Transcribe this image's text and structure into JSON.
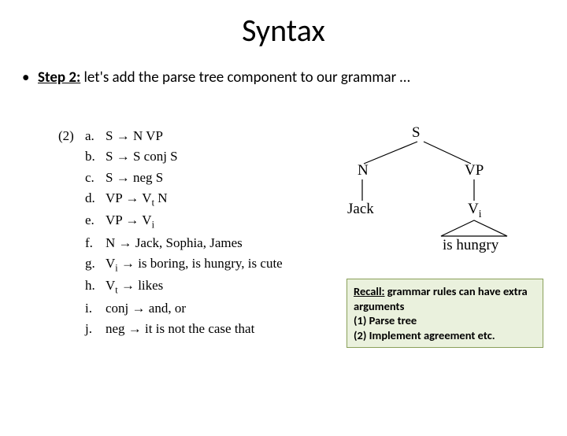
{
  "title": "Syntax",
  "bullet": {
    "marker": "•",
    "step_label": "Step 2:",
    "text": " let's add the parse tree component to our grammar …"
  },
  "grammar": {
    "num": "(2)",
    "rules": [
      {
        "let": "a.",
        "lhs": "S",
        "rhs": "N VP"
      },
      {
        "let": "b.",
        "lhs": "S",
        "rhs": "S conj S"
      },
      {
        "let": "c.",
        "lhs": "S",
        "rhs": "neg S"
      },
      {
        "let": "d.",
        "lhs": "VP",
        "rhs_html": "V<sub class='sub'>t</sub> N"
      },
      {
        "let": "e.",
        "lhs": "VP",
        "rhs_html": "V<sub class='sub'>i</sub>"
      },
      {
        "let": "f.",
        "lhs": "N",
        "rhs": "Jack, Sophia, James"
      },
      {
        "let": "g.",
        "lhs_html": "V<sub class='sub'>i</sub>",
        "rhs": "is boring, is hungry, is cute"
      },
      {
        "let": "h.",
        "lhs_html": "V<sub class='sub'>t</sub>",
        "rhs": "likes"
      },
      {
        "let": "i.",
        "lhs": "conj",
        "rhs": "and, or"
      },
      {
        "let": "j.",
        "lhs": "neg",
        "rhs": "it is not the case that"
      }
    ],
    "arrow": "→"
  },
  "tree": {
    "S": "S",
    "N": "N",
    "VP": "VP",
    "Jack": "Jack",
    "Vi": "V",
    "Vi_sub": "i",
    "is_hungry": "is hungry"
  },
  "callout": {
    "label": "Recall:",
    "intro": " grammar rules can have extra arguments",
    "l1": "(1)  Parse tree",
    "l2": "(2)  Implement agreement etc."
  }
}
